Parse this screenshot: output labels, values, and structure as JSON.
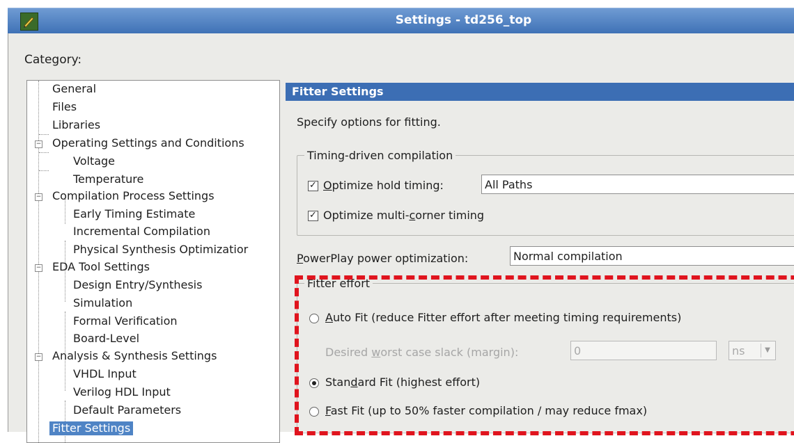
{
  "window": {
    "title": "Settings - td256_top"
  },
  "dialog": {
    "category_label": "Category:"
  },
  "tree": {
    "items": [
      {
        "label": "General"
      },
      {
        "label": "Files"
      },
      {
        "label": "Libraries"
      },
      {
        "label": "Operating Settings and Conditions"
      },
      {
        "label": "Voltage"
      },
      {
        "label": "Temperature"
      },
      {
        "label": "Compilation Process Settings"
      },
      {
        "label": "Early Timing Estimate"
      },
      {
        "label": "Incremental Compilation"
      },
      {
        "label": "Physical Synthesis Optimizatior"
      },
      {
        "label": "EDA Tool Settings"
      },
      {
        "label": "Design Entry/Synthesis"
      },
      {
        "label": "Simulation"
      },
      {
        "label": "Formal Verification"
      },
      {
        "label": "Board-Level"
      },
      {
        "label": "Analysis & Synthesis Settings"
      },
      {
        "label": "VHDL Input"
      },
      {
        "label": "Verilog HDL Input"
      },
      {
        "label": "Default Parameters"
      },
      {
        "label": "Fitter Settings"
      }
    ]
  },
  "panel": {
    "header": "Fitter Settings",
    "description": "Specify options for fitting.",
    "timing_group": {
      "title": "Timing-driven compilation",
      "hold_prefix": "O",
      "hold_rest": "ptimize hold timing:",
      "hold_value": "All Paths",
      "multicorner_prefix": "Optimize multi-",
      "multicorner_ul": "c",
      "multicorner_rest": "orner timing"
    },
    "powerplay": {
      "label_ul": "P",
      "label_rest": "owerPlay power optimization:",
      "value": "Normal compilation"
    },
    "effort_group": {
      "title": "Fitter effort",
      "auto_ul": "A",
      "auto_rest": "uto Fit (reduce Fitter effort after meeting timing requirements)",
      "slack_prefix": "Desired ",
      "slack_ul": "w",
      "slack_rest": "orst case slack (margin):",
      "slack_value": "0",
      "slack_unit": "ns",
      "standard_prefix": "Stan",
      "standard_ul": "d",
      "standard_rest": "ard Fit (highest effort)",
      "fast_ul": "F",
      "fast_rest": "ast Fit (up to 50% faster compilation / may reduce fmax)"
    }
  },
  "colors": {
    "highlight": "#e0141e",
    "title_bar": "#3f72b6",
    "selection": "#4f84c5"
  }
}
